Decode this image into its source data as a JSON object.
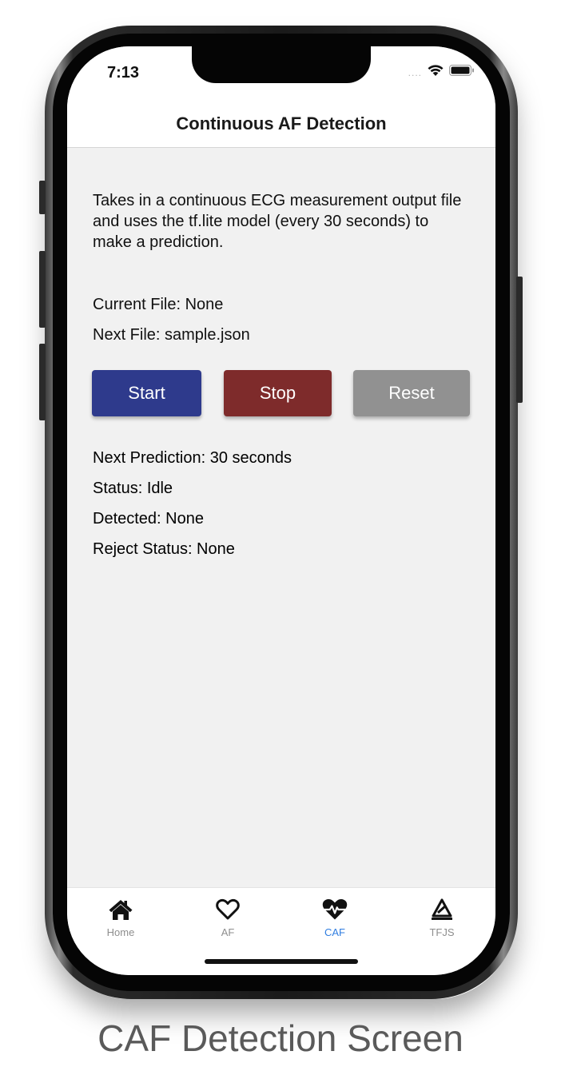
{
  "status_bar": {
    "time": "7:13",
    "signal": "....",
    "icons": [
      "wifi-icon",
      "battery-icon"
    ]
  },
  "nav": {
    "title": "Continuous AF Detection"
  },
  "main": {
    "description": "Takes in a continuous ECG measurement output file and uses the tf.lite model (every 30 seconds) to make a prediction.",
    "current_file": "Current File: None",
    "next_file": "Next File: sample.json",
    "buttons": {
      "start": "Start",
      "stop": "Stop",
      "reset": "Reset"
    },
    "next_prediction": "Next Prediction: 30 seconds",
    "status": "Status: Idle",
    "detected": "Detected: None",
    "reject_status": "Reject Status: None"
  },
  "tabs": [
    {
      "label": "Home",
      "icon": "home-icon",
      "active": false
    },
    {
      "label": "AF",
      "icon": "heart-outline-icon",
      "active": false
    },
    {
      "label": "CAF",
      "icon": "heartbeat-icon",
      "active": true
    },
    {
      "label": "TFJS",
      "icon": "tfjs-icon",
      "active": false
    }
  ],
  "colors": {
    "start_button": "#2e3a8c",
    "stop_button": "#7e2b2b",
    "reset_button": "#919191",
    "active_tab": "#2f7de0",
    "inactive_tab": "#8e8e8e",
    "background": "#f1f1f1"
  },
  "caption": "CAF Detection Screen"
}
